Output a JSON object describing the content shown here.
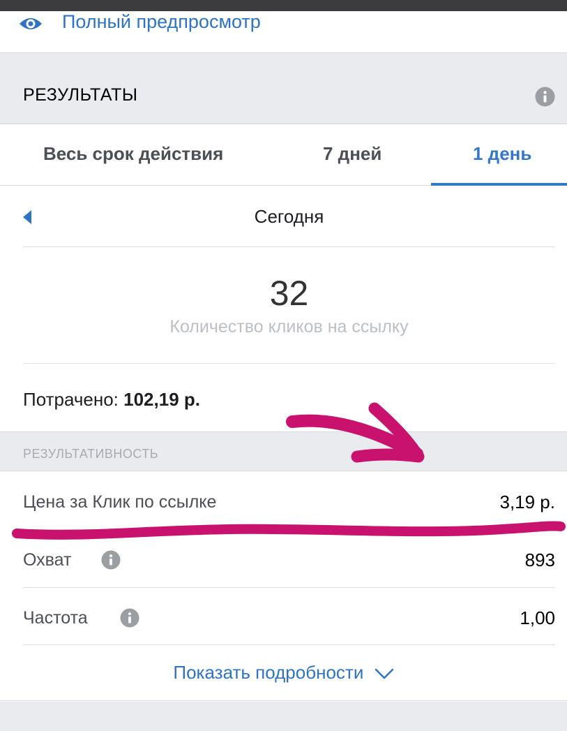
{
  "preview": {
    "label": "Полный предпросмотр"
  },
  "results": {
    "title": "РЕЗУЛЬТАТЫ"
  },
  "tabs": [
    {
      "label": "Весь срок действия",
      "active": false
    },
    {
      "label": "7 дней",
      "active": false
    },
    {
      "label": "1 день",
      "active": true
    }
  ],
  "date": {
    "label": "Сегодня"
  },
  "metric": {
    "value": "32",
    "caption": "Количество кликов на ссылку"
  },
  "spent": {
    "label": "Потрачено:",
    "value": "102,19 р."
  },
  "performance": {
    "title": "РЕЗУЛЬТАТИВНОСТЬ",
    "rows": [
      {
        "label": "Цена за Клик по ссылке",
        "value": "3,19 р.",
        "has_info": false
      },
      {
        "label": "Охват",
        "value": "893",
        "has_info": true
      },
      {
        "label": "Частота",
        "value": "1,00",
        "has_info": true
      }
    ]
  },
  "details": {
    "label": "Показать подробности"
  },
  "colors": {
    "accent": "#3578c8",
    "link": "#2d74c3",
    "annotation": "#c8126e",
    "section_bg": "#e9ebee"
  }
}
